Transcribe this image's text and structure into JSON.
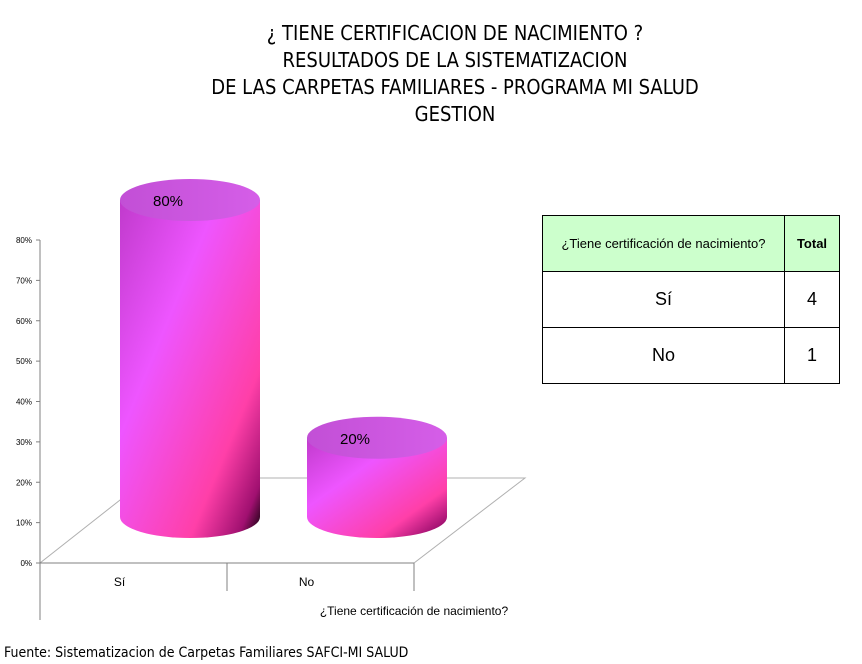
{
  "title": {
    "lines": [
      "¿ TIENE CERTIFICACION DE NACIMIENTO ?",
      "RESULTADOS DE LA SISTEMATIZACION",
      "DE LAS CARPETAS FAMILIARES - PROGRAMA MI SALUD",
      "GESTION"
    ]
  },
  "chart_data": {
    "type": "bar",
    "style": "3d-cylinder",
    "categories": [
      "Sí",
      "No"
    ],
    "values": [
      80,
      20
    ],
    "data_labels": [
      "80%",
      "20%"
    ],
    "xlabel": "¿Tiene certificación de nacimiento?",
    "ylabel": "",
    "ylim": [
      0,
      80
    ],
    "yticks": [
      "0%",
      "10%",
      "20%",
      "30%",
      "40%",
      "50%",
      "60%",
      "70%",
      "80%"
    ],
    "grid": false,
    "legend": "none",
    "bar_color": "#dd44ee"
  },
  "table": {
    "header": [
      "¿Tiene certificación de nacimiento?",
      "Total"
    ],
    "rows": [
      [
        "Sí",
        "4"
      ],
      [
        "No",
        "1"
      ]
    ],
    "header_bg": "#ccffcc"
  },
  "source": "Fuente: Sistematizacion de Carpetas Familiares SAFCI-MI SALUD"
}
